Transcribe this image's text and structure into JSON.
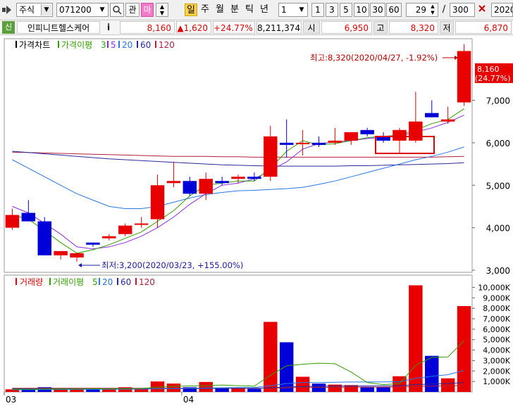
{
  "toolbar": {
    "market_type": "주식",
    "code": "071200",
    "btn_watch": "관",
    "btn_ma": "마",
    "btn_day": "일",
    "btn_week": "주",
    "btn_month": "월",
    "btn_minute": "분",
    "btn_tick": "틱",
    "btn_year": "년",
    "period_select": "1",
    "periods": [
      "1",
      "3",
      "5",
      "10",
      "30",
      "60"
    ],
    "count_value": "29",
    "slash": "/",
    "total_value": "300",
    "date_value": "2020"
  },
  "stock": {
    "badge": "신",
    "name": "인피니트헬스케어",
    "info_btn": "i",
    "price": "8,160",
    "change": "▲1,620",
    "change_pct": "+24.77%",
    "volume": "8,211,374",
    "open_label": "시",
    "open": "6,950",
    "high_label": "고",
    "high": "8,320",
    "low_label": "저",
    "low": "6,870"
  },
  "colors": {
    "up": "#e80000",
    "down": "#0000d8",
    "ma5": "#32a000",
    "ma20": "#2878e6",
    "ma60": "#2a2a9a",
    "ma120": "#b41e3c"
  },
  "price_panel": {
    "legend_title": "가격차트",
    "legend_ma": "가격이평",
    "legend_periods": [
      "3",
      "5",
      "20",
      "60",
      "120"
    ],
    "max_annotation": "최고:8,320(2020/04/27, -1.92%)",
    "min_annotation": "최저:3,200(2020/03/23, +155.00%)",
    "current_price_label": "8,160",
    "current_pct_label": "(24.77%)"
  },
  "volume_panel": {
    "legend_title": "거래량",
    "legend_ma": "거래이평",
    "legend_periods": [
      "5",
      "20",
      "60",
      "120"
    ]
  },
  "chart_data": {
    "type": "candlestick",
    "x_axis_labels": [
      "03",
      "04"
    ],
    "price_ticks": [
      3000,
      4000,
      5000,
      6000,
      7000
    ],
    "price_tick_labels": [
      "3,000",
      "4,000",
      "5,000",
      "6,000",
      "7,000"
    ],
    "ylim_price": [
      2950,
      8450
    ],
    "volume_ticks": [
      1000,
      2000,
      3000,
      4000,
      5000,
      6000,
      7000,
      8000,
      9000,
      10000
    ],
    "volume_tick_labels": [
      "1,000K",
      "2,000K",
      "3,000K",
      "4,000K",
      "5,000K",
      "6,000K",
      "7,000K",
      "8,000K",
      "9,000K",
      "10,000K"
    ],
    "ylim_volume": [
      0,
      10500
    ],
    "candles": [
      {
        "o": 4000,
        "h": 4450,
        "l": 3950,
        "c": 4300,
        "v": 250
      },
      {
        "o": 4350,
        "h": 4650,
        "l": 4150,
        "c": 4150,
        "v": 300
      },
      {
        "o": 4150,
        "h": 4250,
        "l": 3350,
        "c": 3350,
        "v": 450
      },
      {
        "o": 3350,
        "h": 3400,
        "l": 3250,
        "c": 3450,
        "v": 300
      },
      {
        "o": 3300,
        "h": 3400,
        "l": 3200,
        "c": 3400,
        "v": 250
      },
      {
        "o": 3650,
        "h": 3650,
        "l": 3550,
        "c": 3600,
        "v": 300
      },
      {
        "o": 3750,
        "h": 3850,
        "l": 3700,
        "c": 3800,
        "v": 250
      },
      {
        "o": 3850,
        "h": 4100,
        "l": 3800,
        "c": 4050,
        "v": 450
      },
      {
        "o": 4100,
        "h": 4250,
        "l": 4000,
        "c": 4100,
        "v": 300
      },
      {
        "o": 4200,
        "h": 5250,
        "l": 4000,
        "c": 5000,
        "v": 1000
      },
      {
        "o": 5050,
        "h": 5550,
        "l": 4950,
        "c": 5100,
        "v": 800
      },
      {
        "o": 5100,
        "h": 5200,
        "l": 4750,
        "c": 4800,
        "v": 450
      },
      {
        "o": 4800,
        "h": 5300,
        "l": 4650,
        "c": 5150,
        "v": 950
      },
      {
        "o": 5100,
        "h": 5200,
        "l": 5000,
        "c": 5050,
        "v": 350
      },
      {
        "o": 5150,
        "h": 5250,
        "l": 5050,
        "c": 5200,
        "v": 350
      },
      {
        "o": 5200,
        "h": 5300,
        "l": 5100,
        "c": 5150,
        "v": 300
      },
      {
        "o": 5200,
        "h": 6400,
        "l": 5100,
        "c": 6150,
        "v": 6700
      },
      {
        "o": 6000,
        "h": 6550,
        "l": 5650,
        "c": 5950,
        "v": 4750
      },
      {
        "o": 6000,
        "h": 6300,
        "l": 5700,
        "c": 6000,
        "v": 1450
      },
      {
        "o": 6000,
        "h": 6150,
        "l": 5900,
        "c": 5950,
        "v": 800
      },
      {
        "o": 6000,
        "h": 6350,
        "l": 5950,
        "c": 6050,
        "v": 700
      },
      {
        "o": 6050,
        "h": 6250,
        "l": 5950,
        "c": 6250,
        "v": 650
      },
      {
        "o": 6300,
        "h": 6350,
        "l": 6150,
        "c": 6200,
        "v": 500
      },
      {
        "o": 6150,
        "h": 6250,
        "l": 6000,
        "c": 6050,
        "v": 450
      },
      {
        "o": 6050,
        "h": 6350,
        "l": 5750,
        "c": 6300,
        "v": 1500
      },
      {
        "o": 6050,
        "h": 7200,
        "l": 6000,
        "c": 6500,
        "v": 10200
      },
      {
        "o": 6700,
        "h": 7000,
        "l": 6600,
        "c": 6600,
        "v": 3450
      },
      {
        "o": 6500,
        "h": 6850,
        "l": 6450,
        "c": 6550,
        "v": 1300
      },
      {
        "o": 6950,
        "h": 8320,
        "l": 6870,
        "c": 8160,
        "v": 8211
      }
    ],
    "ma3": [
      4300,
      4200,
      3930,
      3650,
      3400,
      3480,
      3600,
      3750,
      3900,
      4150,
      4400,
      4750,
      5000,
      5050,
      5100,
      5100,
      5400,
      5800,
      6050,
      5950,
      5980,
      6050,
      6120,
      6150,
      6180,
      6300,
      6450,
      6550,
      6800
    ],
    "ma5": [
      4500,
      4350,
      4100,
      3850,
      3550,
      3500,
      3550,
      3650,
      3800,
      4000,
      4250,
      4550,
      4800,
      5000,
      5050,
      5150,
      5350,
      5550,
      5850,
      5980,
      6020,
      6050,
      6100,
      6130,
      6160,
      6250,
      6350,
      6480,
      6650
    ],
    "ma20": [
      5600,
      5400,
      5200,
      5000,
      4800,
      4650,
      4500,
      4450,
      4450,
      4500,
      4600,
      4700,
      4780,
      4830,
      4870,
      4880,
      4900,
      4920,
      4950,
      5020,
      5100,
      5200,
      5300,
      5400,
      5500,
      5600,
      5680,
      5780,
      5900
    ],
    "ma60": [
      5800,
      5770,
      5740,
      5710,
      5680,
      5650,
      5620,
      5600,
      5580,
      5560,
      5540,
      5520,
      5500,
      5480,
      5470,
      5460,
      5450,
      5450,
      5450,
      5450,
      5450,
      5460,
      5460,
      5470,
      5480,
      5490,
      5500,
      5510,
      5530
    ],
    "ma120": [
      5780,
      5770,
      5760,
      5750,
      5740,
      5730,
      5720,
      5710,
      5700,
      5690,
      5680,
      5680,
      5680,
      5670,
      5670,
      5660,
      5660,
      5660,
      5660,
      5660,
      5660,
      5660,
      5660,
      5660,
      5660,
      5660,
      5660,
      5670,
      5680
    ],
    "vma5": [
      250,
      250,
      270,
      280,
      290,
      300,
      300,
      320,
      330,
      450,
      530,
      570,
      600,
      650,
      600,
      550,
      1600,
      2500,
      2650,
      2750,
      2700,
      1900,
      900,
      700,
      800,
      2550,
      3300,
      3350,
      4900
    ],
    "vma20": [
      200,
      210,
      220,
      230,
      240,
      250,
      250,
      260,
      270,
      300,
      320,
      350,
      380,
      400,
      420,
      430,
      600,
      800,
      900,
      900,
      920,
      950,
      950,
      960,
      980,
      1300,
      1500,
      1650,
      2050
    ],
    "vma60": [
      300,
      300,
      300,
      300,
      300,
      300,
      300,
      300,
      300,
      310,
      310,
      320,
      330,
      340,
      350,
      350,
      400,
      480,
      520,
      540,
      560,
      570,
      580,
      590,
      600,
      700,
      760,
      800,
      900
    ],
    "vma120": [
      350,
      350,
      350,
      350,
      350,
      350,
      350,
      350,
      350,
      350,
      350,
      350,
      360,
      360,
      360,
      360,
      380,
      400,
      420,
      430,
      440,
      450,
      460,
      470,
      480,
      520,
      550,
      580,
      620
    ]
  }
}
